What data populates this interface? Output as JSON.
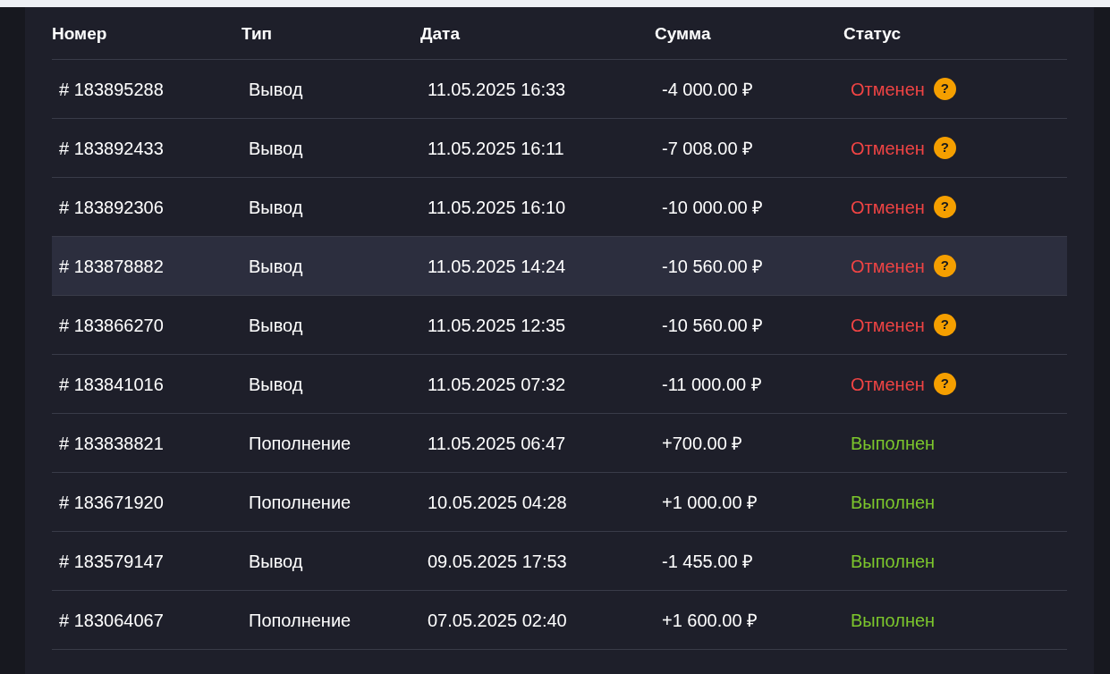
{
  "table": {
    "columns": [
      "Номер",
      "Тип",
      "Дата",
      "Сумма",
      "Статус"
    ],
    "rows": [
      {
        "number": "# 183895288",
        "type": "Вывод",
        "date": "11.05.2025 16:33",
        "amount": "-4 000.00 ₽",
        "status": "Отменен",
        "kind": "cancelled",
        "help": "?",
        "highlighted": false
      },
      {
        "number": "# 183892433",
        "type": "Вывод",
        "date": "11.05.2025 16:11",
        "amount": "-7 008.00 ₽",
        "status": "Отменен",
        "kind": "cancelled",
        "help": "?",
        "highlighted": false
      },
      {
        "number": "# 183892306",
        "type": "Вывод",
        "date": "11.05.2025 16:10",
        "amount": "-10 000.00 ₽",
        "status": "Отменен",
        "kind": "cancelled",
        "help": "?",
        "highlighted": false
      },
      {
        "number": "# 183878882",
        "type": "Вывод",
        "date": "11.05.2025 14:24",
        "amount": "-10 560.00 ₽",
        "status": "Отменен",
        "kind": "cancelled",
        "help": "?",
        "highlighted": true
      },
      {
        "number": "# 183866270",
        "type": "Вывод",
        "date": "11.05.2025 12:35",
        "amount": "-10 560.00 ₽",
        "status": "Отменен",
        "kind": "cancelled",
        "help": "?",
        "highlighted": false
      },
      {
        "number": "# 183841016",
        "type": "Вывод",
        "date": "11.05.2025 07:32",
        "amount": "-11 000.00 ₽",
        "status": "Отменен",
        "kind": "cancelled",
        "help": "?",
        "highlighted": false
      },
      {
        "number": "# 183838821",
        "type": "Пополнение",
        "date": "11.05.2025 06:47",
        "amount": "+700.00 ₽",
        "status": "Выполнен",
        "kind": "done",
        "highlighted": false
      },
      {
        "number": "# 183671920",
        "type": "Пополнение",
        "date": "10.05.2025 04:28",
        "amount": "+1 000.00 ₽",
        "status": "Выполнен",
        "kind": "done",
        "highlighted": false
      },
      {
        "number": "# 183579147",
        "type": "Вывод",
        "date": "09.05.2025 17:53",
        "amount": "-1 455.00 ₽",
        "status": "Выполнен",
        "kind": "done",
        "highlighted": false
      },
      {
        "number": "# 183064067",
        "type": "Пополнение",
        "date": "07.05.2025 02:40",
        "amount": "+1 600.00 ₽",
        "status": "Выполнен",
        "kind": "done",
        "highlighted": false
      }
    ]
  }
}
